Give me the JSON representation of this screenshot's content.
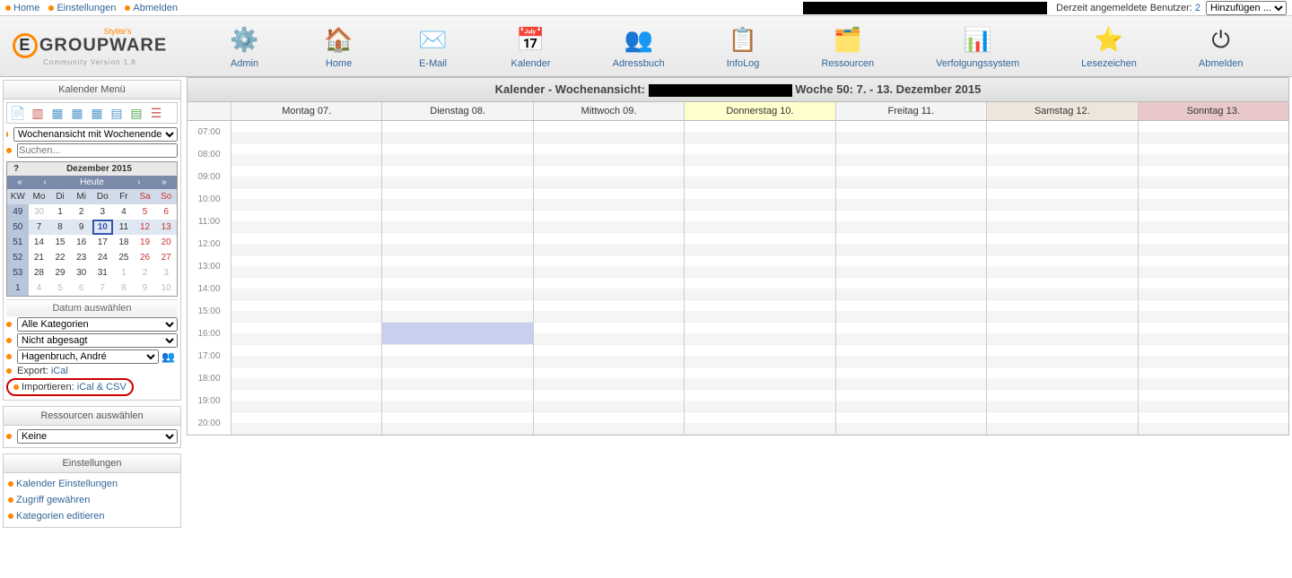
{
  "topnav": {
    "home": "Home",
    "settings": "Einstellungen",
    "logout": "Abmelden",
    "users_label": "Derzeit angemeldete Benutzer:",
    "users_count": "2",
    "add_select": "Hinzufügen ..."
  },
  "logo": {
    "stylite": "Stylite's",
    "main": "GROUPWARE",
    "sub": "Community Version 1.8"
  },
  "apps": [
    {
      "id": "admin",
      "label": "Admin",
      "icon": "⚙️"
    },
    {
      "id": "home",
      "label": "Home",
      "icon": "🏠"
    },
    {
      "id": "email",
      "label": "E-Mail",
      "icon": "✉️"
    },
    {
      "id": "kalender",
      "label": "Kalender",
      "icon": "📅"
    },
    {
      "id": "adressbuch",
      "label": "Adressbuch",
      "icon": "👥"
    },
    {
      "id": "infolog",
      "label": "InfoLog",
      "icon": "📋"
    },
    {
      "id": "ressourcen",
      "label": "Ressourcen",
      "icon": "🗂️"
    },
    {
      "id": "verfolgung",
      "label": "Verfolgungssystem",
      "icon": "📊"
    },
    {
      "id": "lesezeichen",
      "label": "Lesezeichen",
      "icon": "⭐"
    },
    {
      "id": "abmelden",
      "label": "Abmelden",
      "icon": "⏻"
    }
  ],
  "sidebar": {
    "menu_title": "Kalender Menü",
    "view_select": "Wochenansicht mit Wochenende",
    "search_placeholder": "Suchen...",
    "minical": {
      "q": "?",
      "title": "Dezember 2015",
      "nav_prev2": "«",
      "nav_prev": "‹",
      "heute": "Heute",
      "nav_next": "›",
      "nav_next2": "»",
      "dow": [
        "KW",
        "Mo",
        "Di",
        "Mi",
        "Do",
        "Fr",
        "Sa",
        "So"
      ],
      "rows": [
        {
          "kw": "49",
          "days": [
            "30",
            "1",
            "2",
            "3",
            "4",
            "5",
            "6"
          ],
          "other": [
            0
          ]
        },
        {
          "kw": "50",
          "days": [
            "7",
            "8",
            "9",
            "10",
            "11",
            "12",
            "13"
          ],
          "today": 3,
          "current": true
        },
        {
          "kw": "51",
          "days": [
            "14",
            "15",
            "16",
            "17",
            "18",
            "19",
            "20"
          ]
        },
        {
          "kw": "52",
          "days": [
            "21",
            "22",
            "23",
            "24",
            "25",
            "26",
            "27"
          ]
        },
        {
          "kw": "53",
          "days": [
            "28",
            "29",
            "30",
            "31",
            "1",
            "2",
            "3"
          ],
          "other": [
            4,
            5,
            6
          ]
        },
        {
          "kw": "1",
          "days": [
            "4",
            "5",
            "6",
            "7",
            "8",
            "9",
            "10"
          ],
          "other": [
            0,
            1,
            2,
            3,
            4,
            5,
            6
          ]
        }
      ]
    },
    "date_section": "Datum auswählen",
    "cat_select": "Alle Kategorien",
    "status_select": "Nicht abgesagt",
    "user_select": "Hagenbruch, André",
    "export_label": "Export:",
    "export_link": "iCal",
    "import_label": "Importieren:",
    "import_link": "iCal & CSV",
    "res_title": "Ressourcen auswählen",
    "res_select": "Keine",
    "settings_title": "Einstellungen",
    "settings_links": [
      "Kalender Einstellungen",
      "Zugriff gewähren",
      "Kategorien editieren"
    ]
  },
  "calendar": {
    "title_prefix": "Kalender - Wochenansicht:",
    "title_week": "Woche 50: 7. - 13. Dezember 2015",
    "days": [
      "Montag 07.",
      "Dienstag 08.",
      "Mittwoch 09.",
      "Donnerstag 10.",
      "Freitag 11.",
      "Samstag 12.",
      "Sonntag 13."
    ],
    "hours": [
      "07:00",
      "08:00",
      "09:00",
      "10:00",
      "11:00",
      "12:00",
      "13:00",
      "14:00",
      "15:00",
      "16:00",
      "17:00",
      "18:00",
      "19:00",
      "20:00"
    ]
  }
}
